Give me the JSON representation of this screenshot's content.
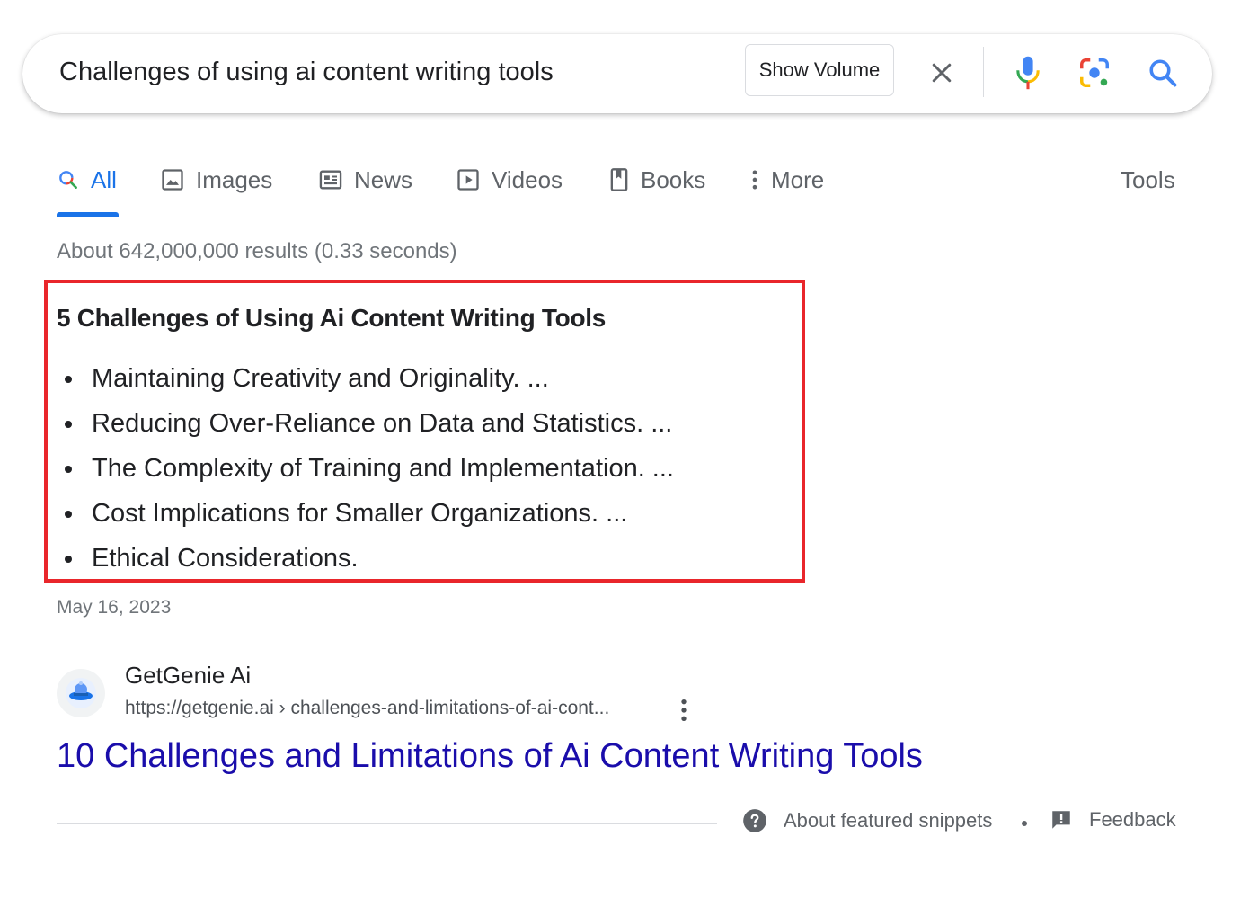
{
  "search": {
    "query": "Challenges of using ai content writing tools",
    "show_volume_label": "Show Volume"
  },
  "tabs": [
    {
      "label": "All",
      "icon": "search-icon",
      "active": true
    },
    {
      "label": "Images",
      "icon": "image-icon"
    },
    {
      "label": "News",
      "icon": "news-icon"
    },
    {
      "label": "Videos",
      "icon": "video-icon"
    },
    {
      "label": "Books",
      "icon": "book-icon"
    },
    {
      "label": "More",
      "icon": "more-vert-icon"
    }
  ],
  "tools_label": "Tools",
  "result_stats": "About 642,000,000 results (0.33 seconds)",
  "featured_snippet": {
    "title": "5 Challenges of Using Ai Content Writing Tools",
    "items": [
      "Maintaining Creativity and Originality. ...",
      "Reducing Over-Reliance on Data and Statistics. ...",
      "The Complexity of Training and Implementation. ...",
      "Cost Implications for Smaller Organizations. ...",
      "Ethical Considerations."
    ],
    "date": "May 16, 2023",
    "highlight_color": "#e9262b"
  },
  "source": {
    "site_name": "GetGenie Ai",
    "url": "https://getgenie.ai › challenges-and-limitations-of-ai-cont...",
    "result_title": "10 Challenges and Limitations of Ai Content Writing Tools"
  },
  "footer": {
    "about_label": "About featured snippets",
    "separator": "•",
    "feedback_label": "Feedback"
  },
  "colors": {
    "accent": "#1a73e8",
    "link": "#1a0dab",
    "muted": "#70757a"
  }
}
